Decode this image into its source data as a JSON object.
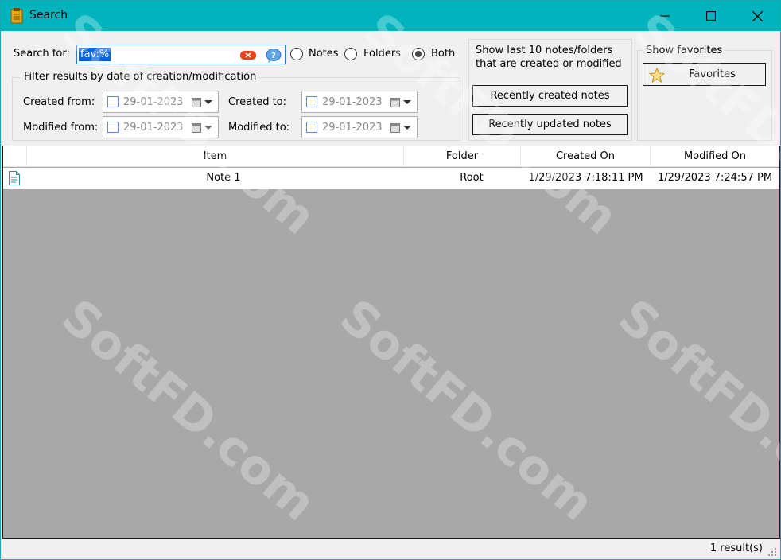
{
  "window": {
    "title": "Search"
  },
  "search": {
    "label": "Search for:",
    "value": "fav:%",
    "scope_options": [
      {
        "label": "Notes",
        "selected": false
      },
      {
        "label": "Folders",
        "selected": false
      },
      {
        "label": "Both",
        "selected": true
      }
    ]
  },
  "date_filter": {
    "legend": "Filter results by date of creation/modification",
    "created_from": {
      "label": "Created from:",
      "value": "29-01-2023"
    },
    "created_to": {
      "label": "Created to:",
      "value": "29-01-2023"
    },
    "modified_from": {
      "label": "Modified from:",
      "value": "29-01-2023"
    },
    "modified_to": {
      "label": "Modified to:",
      "value": "29-01-2023"
    }
  },
  "recent": {
    "description_line1": "Show last 10 notes/folders",
    "description_line2": "that are created or modified",
    "created_button": "Recently created notes",
    "updated_button": "Recently updated notes"
  },
  "favorites": {
    "legend": "Show favorites",
    "button": "Favorites"
  },
  "results": {
    "columns": [
      "Item",
      "Folder",
      "Created On",
      "Modified On"
    ],
    "rows": [
      {
        "item": "Note 1",
        "folder": "Root",
        "created": "1/29/2023 7:18:11 PM",
        "modified": "1/29/2023 7:24:57 PM"
      }
    ]
  },
  "status": {
    "count_text": "1 result(s)"
  },
  "watermark": "SoftFD.com",
  "colors": {
    "titlebar": "#00b4be",
    "selection": "#0a64d8",
    "list_empty": "#a8a8a8"
  }
}
